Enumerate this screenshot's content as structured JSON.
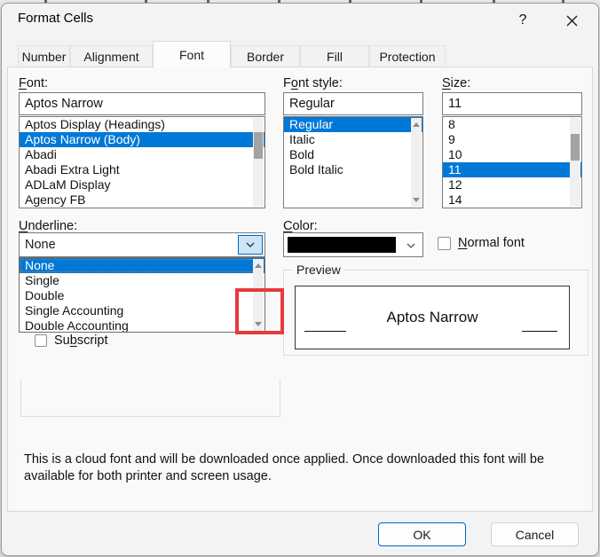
{
  "window": {
    "title": "Format Cells",
    "help_glyph": "?"
  },
  "tabs": [
    {
      "label": "Number",
      "active": false
    },
    {
      "label": "Alignment",
      "active": false
    },
    {
      "label": "Font",
      "active": true
    },
    {
      "label": "Border",
      "active": false
    },
    {
      "label": "Fill",
      "active": false
    },
    {
      "label": "Protection",
      "active": false
    }
  ],
  "font_section": {
    "label": {
      "pre": "",
      "accel": "F",
      "post": "ont:"
    },
    "value": "Aptos Narrow",
    "items": [
      {
        "label": "Aptos Display (Headings)",
        "selected": false
      },
      {
        "label": "Aptos Narrow (Body)",
        "selected": true
      },
      {
        "label": "Abadi",
        "selected": false
      },
      {
        "label": "Abadi Extra Light",
        "selected": false
      },
      {
        "label": "ADLaM Display",
        "selected": false
      },
      {
        "label": "Agency FB",
        "selected": false
      }
    ]
  },
  "style_section": {
    "label": {
      "pre": "F",
      "accel": "o",
      "post": "nt style:"
    },
    "value": "Regular",
    "items": [
      {
        "label": "Regular",
        "selected": true
      },
      {
        "label": "Italic",
        "selected": false
      },
      {
        "label": "Bold",
        "selected": false
      },
      {
        "label": "Bold Italic",
        "selected": false
      }
    ]
  },
  "size_section": {
    "label": {
      "pre": "",
      "accel": "S",
      "post": "ize:"
    },
    "value": "11",
    "items": [
      {
        "label": "8",
        "selected": false
      },
      {
        "label": "9",
        "selected": false
      },
      {
        "label": "10",
        "selected": false
      },
      {
        "label": "11",
        "selected": true
      },
      {
        "label": "12",
        "selected": false
      },
      {
        "label": "14",
        "selected": false
      }
    ]
  },
  "underline_section": {
    "label": {
      "pre": "",
      "accel": "U",
      "post": "nderline:"
    },
    "value": "None",
    "options": [
      {
        "label": "None",
        "selected": true
      },
      {
        "label": "Single",
        "selected": false
      },
      {
        "label": "Double",
        "selected": false
      },
      {
        "label": "Single Accounting",
        "selected": false
      },
      {
        "label": "Double Accounting",
        "selected": false
      }
    ]
  },
  "color_section": {
    "label": {
      "pre": "",
      "accel": "C",
      "post": "olor:"
    },
    "swatch_color": "#000000"
  },
  "normal_font": {
    "label": {
      "pre": "",
      "accel": "N",
      "post": "ormal font"
    },
    "checked": false
  },
  "effects": {
    "subscript": {
      "pre": "Su",
      "accel": "b",
      "post": "script"
    },
    "checked": false
  },
  "preview": {
    "legend": "Preview",
    "text": "Aptos Narrow"
  },
  "note": "This is a cloud font and will be downloaded once applied. Once downloaded this font will be available for both printer and screen usage.",
  "buttons": {
    "ok": "OK",
    "cancel": "Cancel"
  },
  "colors": {
    "selection": "#0078d7",
    "annotation_red": "#e8393d",
    "combo_highlight_bg": "#cce4f7",
    "combo_highlight_border": "#0067c0",
    "color_swatch": "#000000"
  }
}
